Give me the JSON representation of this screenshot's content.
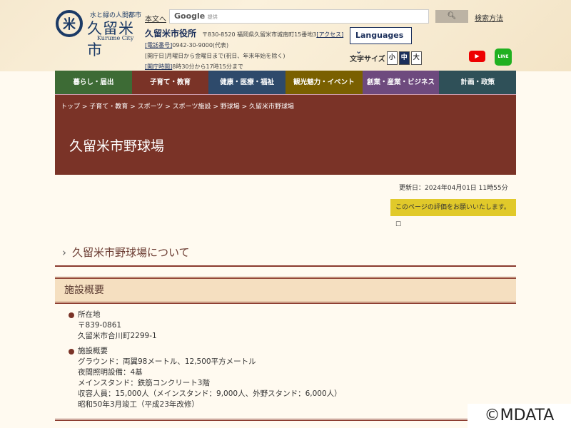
{
  "header": {
    "logo": {
      "tagline": "水と緑の人間都市",
      "name": "久留米市",
      "english": "Kurume City"
    },
    "skip_link": "本文へ",
    "search_placeholder": "Google",
    "search_provider": "提供",
    "search_button_icon": "search-icon",
    "search_help": "検索方法",
    "office": {
      "name": "久留米市役所",
      "address": "〒830-8520 福岡県久留米市城南町15番地3",
      "access": "[アクセス]",
      "phone_label": "[電話番号]",
      "phone": "0942-30-9000(代表)",
      "open_days": "[開庁日]月曜日から金曜日まで(祝日、年末年始を除く)",
      "hours_label": "[開庁時間]",
      "hours": "8時30分から17時15分まで"
    },
    "languages": "Languages",
    "font_size_label": "文字サイズ",
    "font_sizes": [
      "小",
      "中",
      "大"
    ],
    "font_size_selected": "中",
    "social": {
      "youtube": "youtube-icon",
      "line": "LINE"
    }
  },
  "nav": [
    {
      "label": "暮らし・届出",
      "color": "#3d6b35"
    },
    {
      "label": "子育て・教育",
      "color": "#7a3327"
    },
    {
      "label": "健康・医療・福祉",
      "color": "#2e4a6b"
    },
    {
      "label": "観光魅力・イベント",
      "color": "#7a6000"
    },
    {
      "label": "創業・産業・ビジネス",
      "color": "#6e4a7e"
    },
    {
      "label": "計画・政策",
      "color": "#2f5058"
    }
  ],
  "breadcrumb": [
    "トップ",
    "子育て・教育",
    "スポーツ",
    "スポーツ施設",
    "野球場"
  ],
  "breadcrumb_current": "久留米市野球場",
  "page_title": "久留米市野球場",
  "updated": "更新日：2024年04月01日 11時55分",
  "evaluation_link": "このページの評価をお願いいたします。",
  "section_heading": "久留米市野球場について",
  "subsection_heading": "施設概要",
  "items": [
    {
      "title": "所在地",
      "lines": [
        "〒839-0861",
        "久留米市合川町2299-1"
      ]
    },
    {
      "title": "施設概要",
      "lines": [
        "グラウンド：両翼98メートル、12,500平方メートル",
        "夜間照明設備：4基",
        "メインスタンド：鉄筋コンクリート3階",
        "収容人員：15,000人（メインスタンド：9,000人、外野スタンド：6,000人）",
        "昭和50年3月竣工（平成23年改修）"
      ]
    }
  ],
  "watermark": "©MDATA"
}
